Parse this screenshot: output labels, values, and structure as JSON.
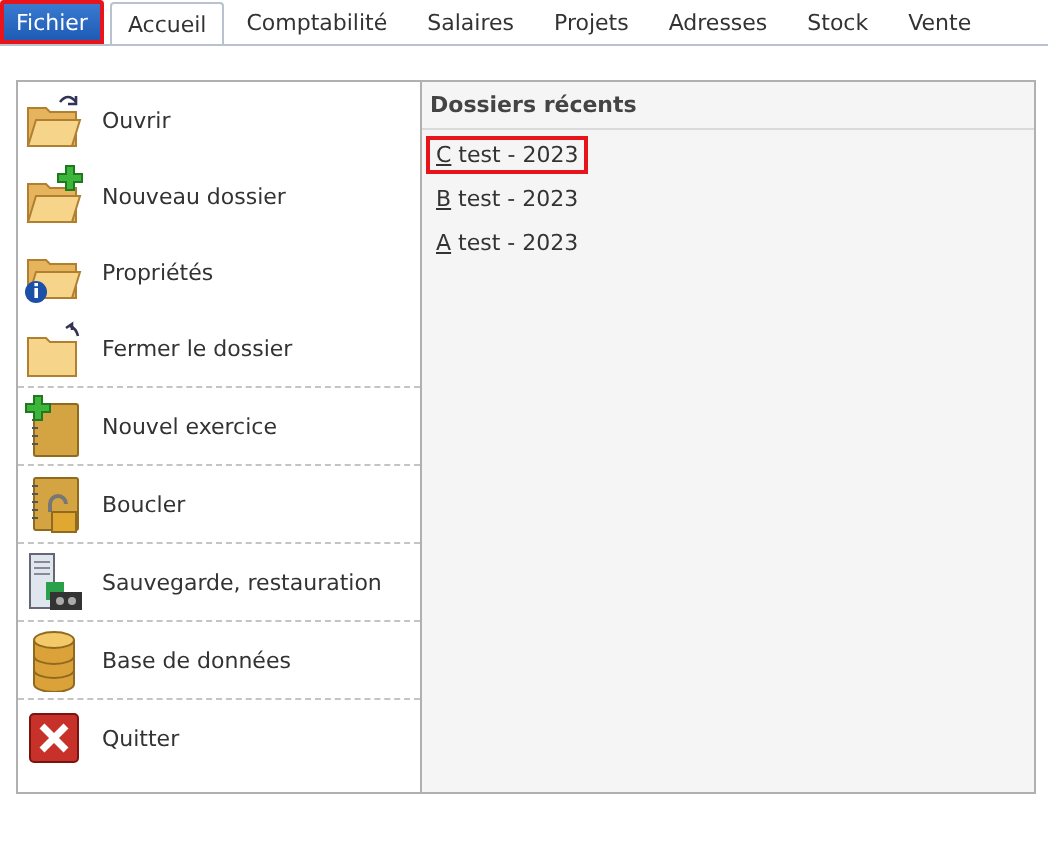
{
  "tabs": [
    {
      "label": "Fichier",
      "selected": true,
      "highlighted": true
    },
    {
      "label": "Accueil",
      "selected": false,
      "highlighted": false
    },
    {
      "label": "Comptabilité",
      "selected": false,
      "highlighted": false
    },
    {
      "label": "Salaires",
      "selected": false,
      "highlighted": false
    },
    {
      "label": "Projets",
      "selected": false,
      "highlighted": false
    },
    {
      "label": "Adresses",
      "selected": false,
      "highlighted": false
    },
    {
      "label": "Stock",
      "selected": false,
      "highlighted": false
    },
    {
      "label": "Vente",
      "selected": false,
      "highlighted": false
    }
  ],
  "menu_groups": [
    {
      "items": [
        {
          "label": "Ouvrir",
          "kind": "open"
        },
        {
          "label": "Nouveau dossier",
          "kind": "new-folder"
        },
        {
          "label": "Propriétés",
          "kind": "properties"
        },
        {
          "label": "Fermer le dossier",
          "kind": "close-folder"
        }
      ]
    },
    {
      "items": [
        {
          "label": "Nouvel exercice",
          "kind": "new-year"
        }
      ]
    },
    {
      "items": [
        {
          "label": "Boucler",
          "kind": "lock"
        }
      ]
    },
    {
      "items": [
        {
          "label": "Sauvegarde, restauration",
          "kind": "backup"
        }
      ]
    },
    {
      "items": [
        {
          "label": "Base de données",
          "kind": "database"
        }
      ]
    },
    {
      "items": [
        {
          "label": "Quitter",
          "kind": "quit"
        }
      ]
    }
  ],
  "recent": {
    "title": "Dossiers récents",
    "items": [
      {
        "mnemonic": "C",
        "label": " test - 2023",
        "highlighted": true
      },
      {
        "mnemonic": "B",
        "label": " test - 2023",
        "highlighted": false
      },
      {
        "mnemonic": "A",
        "label": " test - 2023",
        "highlighted": false
      }
    ]
  }
}
